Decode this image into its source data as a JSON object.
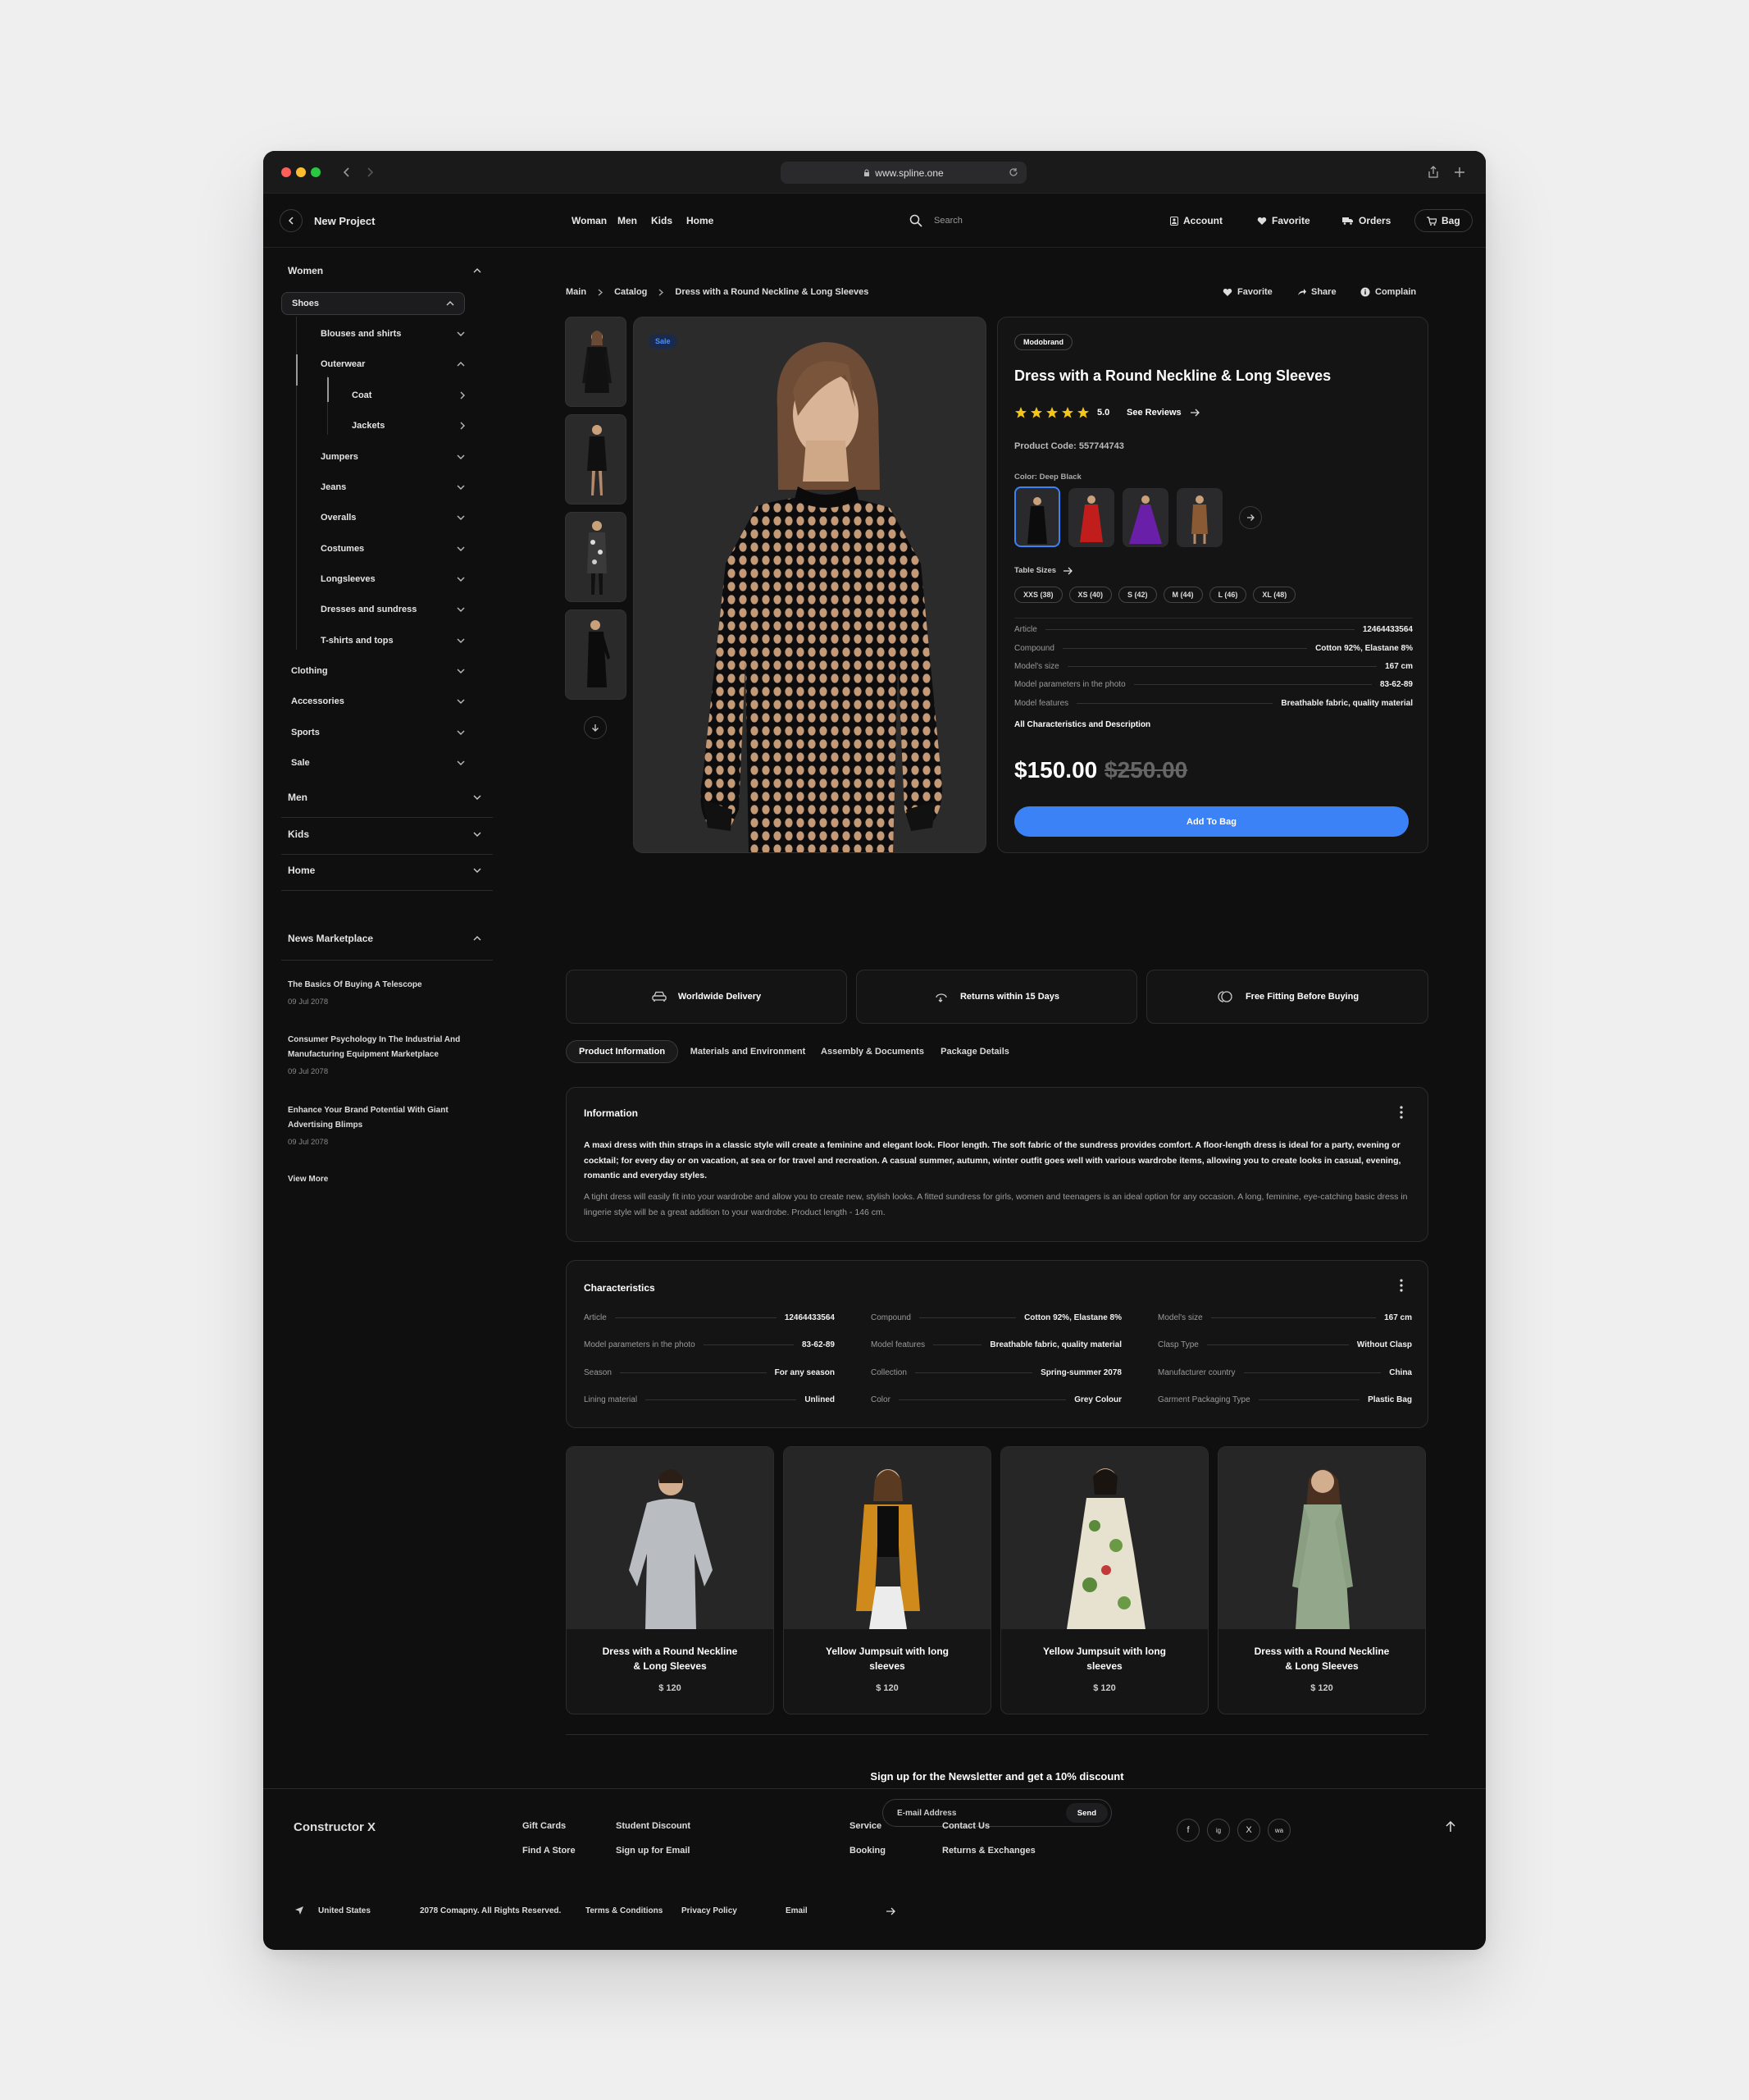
{
  "browser": {
    "url": "www.spline.one"
  },
  "nav": {
    "project": "New Project",
    "links": [
      "Woman",
      "Men",
      "Kids",
      "Home"
    ],
    "search_placeholder": "Search",
    "account": "Account",
    "favorite": "Favorite",
    "orders": "Orders",
    "bag": "Bag"
  },
  "sidebar": {
    "women": "Women",
    "shoes": "Shoes",
    "blouses": "Blouses and shirts",
    "outerwear": "Outerwear",
    "coat": "Coat",
    "jackets": "Jackets",
    "jumpers": "Jumpers",
    "jeans": "Jeans",
    "overalls": "Overalls",
    "costumes": "Costumes",
    "longsleeves": "Longsleeves",
    "dresses": "Dresses and sundress",
    "tshirts": "T-shirts and tops",
    "clothing": "Clothing",
    "accessories": "Accessories",
    "sports": "Sports",
    "sale": "Sale",
    "men": "Men",
    "kids": "Kids",
    "home": "Home",
    "news_title": "News Marketplace",
    "news": [
      {
        "title": "The Basics Of Buying A Telescope",
        "date": "09 Jul 2078"
      },
      {
        "title": "Consumer Psychology In The Industrial And Manufacturing Equipment Marketplace",
        "date": "09 Jul 2078"
      },
      {
        "title": "Enhance Your Brand Potential With Giant Advertising Blimps",
        "date": "09 Jul 2078"
      }
    ],
    "view_more": "View More"
  },
  "breadcrumb": {
    "main": "Main",
    "catalog": "Catalog",
    "current": "Dress with a Round Neckline & Long Sleeves"
  },
  "actions": {
    "favorite": "Favorite",
    "share": "Share",
    "complain": "Complain"
  },
  "product": {
    "sale_badge": "Sale",
    "brand": "Modobrand",
    "title": "Dress with a Round Neckline & Long Sleeves",
    "rating": "5.0",
    "rating_stars": 5,
    "see_reviews": "See Reviews",
    "code": "Product Code: 557744743",
    "color_label": "Color: Deep Black",
    "table_sizes": "Table Sizes",
    "sizes": [
      "XXS (38)",
      "XS (40)",
      "S (42)",
      "M (44)",
      "L (46)",
      "XL (48)"
    ],
    "specs": [
      {
        "k": "Article",
        "v": "12464433564"
      },
      {
        "k": "Compound",
        "v": "Cotton 92%, Elastane 8%"
      },
      {
        "k": "Model's size",
        "v": "167 cm"
      },
      {
        "k": "Model parameters in the photo",
        "v": "83-62-89"
      },
      {
        "k": "Model features",
        "v": "Breathable fabric, quality material"
      }
    ],
    "all_chars": "All Characteristics and Description",
    "price": "$150.00",
    "old_price": "$250.00",
    "add_to_bag": "Add To Bag"
  },
  "features": [
    "Worldwide Delivery",
    "Returns within 15 Days",
    "Free Fitting Before Buying"
  ],
  "tabs": [
    "Product Information",
    "Materials and Environment",
    "Assembly & Documents",
    "Package Details"
  ],
  "information": {
    "title": "Information",
    "p1": "A maxi dress with thin straps in a classic style will create a feminine and elegant look. Floor length. The soft fabric of the sundress provides comfort. A floor-length dress is ideal for a party, evening or cocktail; for every day or on vacation, at sea or for travel and recreation. A casual summer, autumn, winter outfit goes well with various wardrobe items, allowing you to create looks in casual, evening, romantic and everyday styles.",
    "p2": "A tight dress will easily fit into your wardrobe and allow you to create new, stylish looks. A fitted sundress for girls, women and teenagers is an ideal option for any occasion. A long, feminine, eye-catching basic dress in lingerie style will be a great addition to your wardrobe. Product length - 146 cm."
  },
  "characteristics": {
    "title": "Characteristics",
    "cols": [
      [
        {
          "k": "Article",
          "v": "12464433564"
        },
        {
          "k": "Model parameters in the photo",
          "v": "83-62-89"
        },
        {
          "k": "Season",
          "v": "For any season"
        },
        {
          "k": "Lining material",
          "v": "Unlined"
        }
      ],
      [
        {
          "k": "Compound",
          "v": "Cotton 92%, Elastane 8%"
        },
        {
          "k": "Model features",
          "v": "Breathable fabric, quality material"
        },
        {
          "k": "Collection",
          "v": "Spring-summer 2078"
        },
        {
          "k": "Color",
          "v": "Grey Colour"
        }
      ],
      [
        {
          "k": "Model's size",
          "v": "167 cm"
        },
        {
          "k": "Clasp Type",
          "v": "Without Clasp"
        },
        {
          "k": "Manufacturer country",
          "v": "China"
        },
        {
          "k": "Garment Packaging Type",
          "v": "Plastic Bag"
        }
      ]
    ]
  },
  "products": [
    {
      "name": "Dress with a Round Neckline & Long Sleeves",
      "price": "$ 120",
      "color": "#b9bcc0"
    },
    {
      "name": "Yellow Jumpsuit with long sleeves",
      "price": "$ 120",
      "color": "#d08a1c"
    },
    {
      "name": "Yellow Jumpsuit with long sleeves",
      "price": "$ 120",
      "color": "#e6e2cf"
    },
    {
      "name": "Dress with a Round Neckline & Long Sleeves",
      "price": "$ 120",
      "color": "#93a88a"
    }
  ],
  "newsletter": {
    "title": "Sign up for the Newsletter and get a 10% discount",
    "placeholder": "E-mail Address",
    "send": "Send"
  },
  "footer": {
    "brand": "Constructor X",
    "gift_cards": "Gift Cards",
    "find_store": "Find A Store",
    "student": "Student Discount",
    "signup_email": "Sign up for Email",
    "service": "Service",
    "booking": "Booking",
    "contact": "Contact Us",
    "returns": "Returns & Exchanges",
    "country": "United States",
    "copyright": "2078 Comapny. All Rights Reserved.",
    "terms": "Terms & Conditions",
    "privacy": "Privacy Policy",
    "email_label": "Email",
    "social": [
      "f",
      "ig",
      "X",
      "wa"
    ]
  },
  "colors": {
    "accent": "#3b82f6",
    "star": "#f5c518",
    "bg": "#0f0f10",
    "panel": "#141415"
  }
}
